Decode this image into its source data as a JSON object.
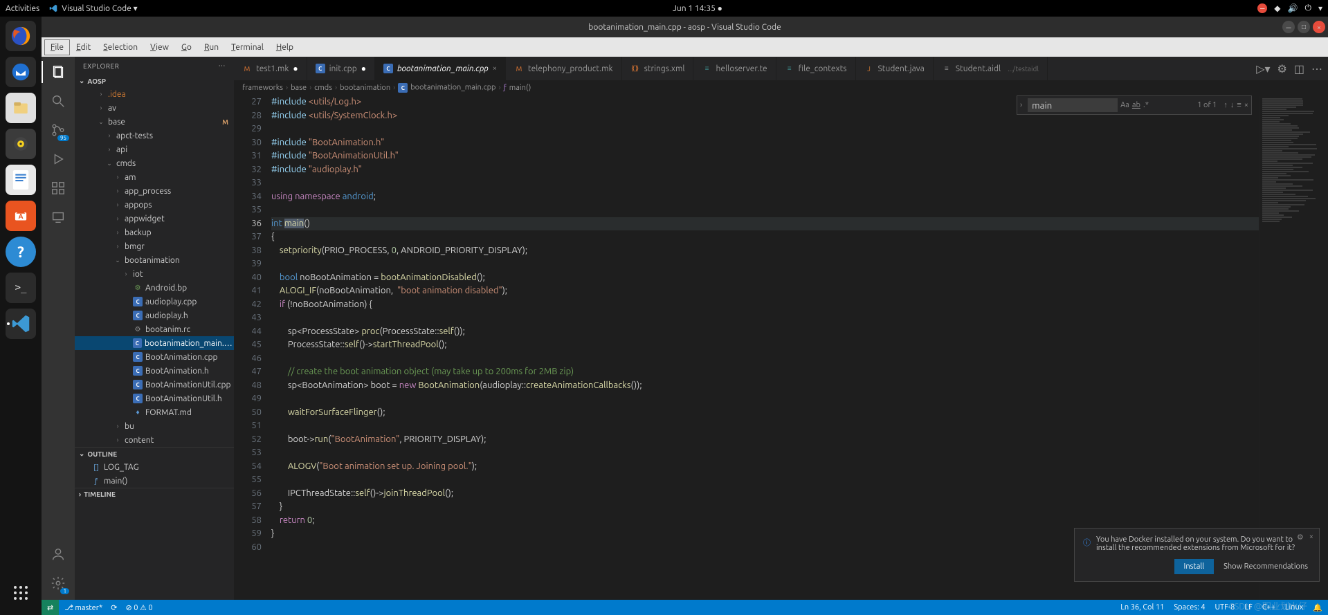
{
  "gnome": {
    "activities": "Activities",
    "app": "Visual Studio Code ▾",
    "clock": "Jun 1  14:35  ●"
  },
  "title": "bootanimation_main.cpp - aosp - Visual Studio Code",
  "menu": [
    "File",
    "Edit",
    "Selection",
    "View",
    "Go",
    "Run",
    "Terminal",
    "Help"
  ],
  "sidebar": {
    "title": "EXPLORER",
    "root": "AOSP",
    "tree": [
      {
        "d": 2,
        "t": "f",
        "i": "›",
        "l": ".idea",
        "c": "#cc7832"
      },
      {
        "d": 2,
        "t": "f",
        "i": "›",
        "l": "av"
      },
      {
        "d": 2,
        "t": "f",
        "i": "⌄",
        "l": "base",
        "m": "M"
      },
      {
        "d": 3,
        "t": "f",
        "i": "›",
        "l": "apct-tests"
      },
      {
        "d": 3,
        "t": "f",
        "i": "›",
        "l": "api"
      },
      {
        "d": 3,
        "t": "f",
        "i": "⌄",
        "l": "cmds"
      },
      {
        "d": 4,
        "t": "f",
        "i": "›",
        "l": "am"
      },
      {
        "d": 4,
        "t": "f",
        "i": "›",
        "l": "app_process"
      },
      {
        "d": 4,
        "t": "f",
        "i": "›",
        "l": "appops"
      },
      {
        "d": 4,
        "t": "f",
        "i": "›",
        "l": "appwidget"
      },
      {
        "d": 4,
        "t": "f",
        "i": "›",
        "l": "backup"
      },
      {
        "d": 4,
        "t": "f",
        "i": "›",
        "l": "bmgr"
      },
      {
        "d": 4,
        "t": "f",
        "i": "⌄",
        "l": "bootanimation"
      },
      {
        "d": 5,
        "t": "f",
        "i": "›",
        "l": "iot"
      },
      {
        "d": 5,
        "t": "i",
        "k": "bp",
        "l": "Android.bp"
      },
      {
        "d": 5,
        "t": "i",
        "k": "c",
        "l": "audioplay.cpp"
      },
      {
        "d": 5,
        "t": "i",
        "k": "c",
        "l": "audioplay.h"
      },
      {
        "d": 5,
        "t": "i",
        "k": "rc",
        "l": "bootanim.rc"
      },
      {
        "d": 5,
        "t": "i",
        "k": "c",
        "l": "bootanimation_main.cpp",
        "sel": true
      },
      {
        "d": 5,
        "t": "i",
        "k": "c",
        "l": "BootAnimation.cpp"
      },
      {
        "d": 5,
        "t": "i",
        "k": "c",
        "l": "BootAnimation.h"
      },
      {
        "d": 5,
        "t": "i",
        "k": "c",
        "l": "BootAnimationUtil.cpp"
      },
      {
        "d": 5,
        "t": "i",
        "k": "c",
        "l": "BootAnimationUtil.h"
      },
      {
        "d": 5,
        "t": "i",
        "k": "md",
        "l": "FORMAT.md"
      },
      {
        "d": 4,
        "t": "f",
        "i": "›",
        "l": "bu"
      },
      {
        "d": 4,
        "t": "f",
        "i": "›",
        "l": "content"
      }
    ],
    "outline": {
      "title": "OUTLINE",
      "items": [
        {
          "i": "[]",
          "l": "LOG_TAG"
        },
        {
          "i": "ƒ",
          "l": "main()"
        }
      ]
    },
    "timeline": {
      "title": "TIMELINE"
    }
  },
  "tabs": [
    {
      "icon": "mk",
      "label": "test1.mk",
      "mod": true
    },
    {
      "icon": "c",
      "label": "init.cpp",
      "mod": true
    },
    {
      "icon": "c",
      "label": "bootanimation_main.cpp",
      "active": true,
      "italic": true
    },
    {
      "icon": "mk",
      "label": "telephony_product.mk"
    },
    {
      "icon": "xml",
      "label": "strings.xml"
    },
    {
      "icon": "te",
      "label": "helloserver.te"
    },
    {
      "icon": "te",
      "label": "file_contexts"
    },
    {
      "icon": "java",
      "label": "Student.java"
    },
    {
      "icon": "aidl",
      "label": "Student.aidl",
      "hint": ".../testaidl"
    }
  ],
  "breadcrumb": [
    "frameworks",
    "base",
    "cmds",
    "bootanimation",
    "bootanimation_main.cpp",
    "main()"
  ],
  "find": {
    "value": "main",
    "result": "1 of 1"
  },
  "code": {
    "start": 27,
    "lines": [
      {
        "h": "<span class='mac'>#include</span> <span class='str'>&lt;utils/Log.h&gt;</span>"
      },
      {
        "h": "<span class='mac'>#include</span> <span class='str'>&lt;utils/SystemClock.h&gt;</span>"
      },
      {
        "h": ""
      },
      {
        "h": "<span class='mac'>#include</span> <span class='str'>\"BootAnimation.h\"</span>"
      },
      {
        "h": "<span class='mac'>#include</span> <span class='str'>\"BootAnimationUtil.h\"</span>"
      },
      {
        "h": "<span class='mac'>#include</span> <span class='str'>\"audioplay.h\"</span>"
      },
      {
        "h": ""
      },
      {
        "h": "<span class='kw'>using</span> <span class='kw'>namespace</span> <span class='ty'>android</span>;"
      },
      {
        "h": ""
      },
      {
        "h": "<span class='ty'>int</span> <span class='fn sel'>main</span>()",
        "cur": true
      },
      {
        "h": "{"
      },
      {
        "h": "    <span class='fn'>setpriority</span>(PRIO_PROCESS, <span class='num'>0</span>, ANDROID_PRIORITY_DISPLAY);"
      },
      {
        "h": ""
      },
      {
        "h": "    <span class='ty'>bool</span> noBootAnimation = <span class='fn'>bootAnimationDisabled</span>();"
      },
      {
        "h": "    <span class='fn'>ALOGI_IF</span>(noBootAnimation,  <span class='str'>\"boot animation disabled\"</span>);"
      },
      {
        "h": "    <span class='kw'>if</span> (!noBootAnimation) {"
      },
      {
        "h": ""
      },
      {
        "h": "        sp&lt;ProcessState&gt; <span class='fn'>proc</span>(ProcessState::<span class='fn'>self</span>());"
      },
      {
        "h": "        ProcessState::<span class='fn'>self</span>()-&gt;<span class='fn'>startThreadPool</span>();"
      },
      {
        "h": ""
      },
      {
        "h": "        <span class='cm'>// create the boot animation object (may take up to 200ms for 2MB zip)</span>"
      },
      {
        "h": "        sp&lt;BootAnimation&gt; boot = <span class='kw'>new</span> <span class='fn'>BootAnimation</span>(audioplay::<span class='fn'>createAnimationCallbacks</span>());"
      },
      {
        "h": ""
      },
      {
        "h": "        <span class='fn'>waitForSurfaceFlinger</span>();"
      },
      {
        "h": ""
      },
      {
        "h": "        boot-&gt;<span class='fn'>run</span>(<span class='str'>\"BootAnimation\"</span>, PRIORITY_DISPLAY);"
      },
      {
        "h": ""
      },
      {
        "h": "        <span class='fn'>ALOGV</span>(<span class='str'>\"Boot animation set up. Joining pool.\"</span>);"
      },
      {
        "h": ""
      },
      {
        "h": "        IPCThreadState::<span class='fn'>self</span>()-&gt;<span class='fn'>joinThreadPool</span>();"
      },
      {
        "h": "    }"
      },
      {
        "h": "    <span class='kw'>return</span> <span class='num'>0</span>;"
      },
      {
        "h": "}"
      },
      {
        "h": ""
      }
    ]
  },
  "toast": {
    "msg": "You have Docker installed on your system. Do you want to install the recommended extensions from Microsoft for it?",
    "primary": "Install",
    "secondary": "Show Recommendations"
  },
  "status": {
    "branch": "master*",
    "err": "0",
    "warn": "0",
    "lncol": "Ln 36, Col 11",
    "spaces": "Spaces: 4",
    "enc": "UTF-8",
    "eol": "LF",
    "lang": "C++",
    "os": "Linux",
    "bell": "🔔"
  },
  "watermark": "CSDN @职业划水仔"
}
